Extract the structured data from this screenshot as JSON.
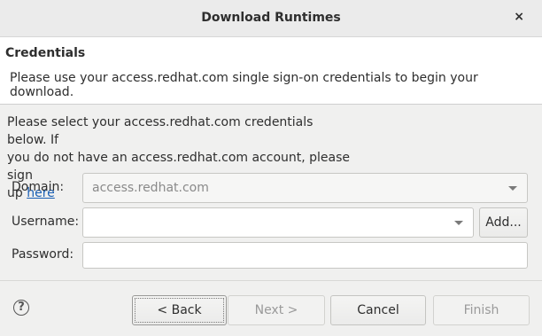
{
  "window": {
    "title": "Download Runtimes",
    "close_glyph": "×"
  },
  "header": {
    "title": "Credentials",
    "description": "Please use your access.redhat.com single sign-on credentials to begin your download."
  },
  "info": {
    "line1": "Please select your access.redhat.com credentials below. If",
    "line2": "you do not have an access.redhat.com account, please sign",
    "line3_prefix": "up ",
    "link_text": "here"
  },
  "form": {
    "domain_label": "Domain:",
    "domain_value": "access.redhat.com",
    "username_label": "Username:",
    "username_value": "",
    "add_button": "Add...",
    "password_label": "Password:",
    "password_value": ""
  },
  "footer": {
    "help_glyph": "?",
    "back": "< Back",
    "next": "Next >",
    "cancel": "Cancel",
    "finish": "Finish"
  }
}
